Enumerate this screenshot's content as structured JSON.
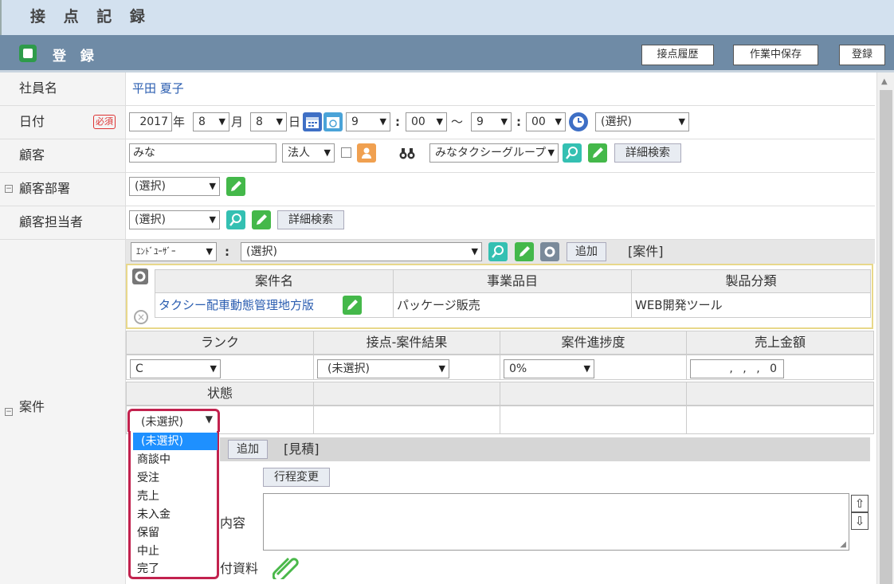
{
  "window": {
    "title": "接 点 記 録"
  },
  "header": {
    "title": "登 録",
    "buttons": [
      "接点履歴",
      "作業中保存",
      "登録"
    ]
  },
  "fields": {
    "employee": {
      "label": "社員名",
      "value": "平田 夏子"
    },
    "date": {
      "label": "日付",
      "required": "必須",
      "year": "2017",
      "year_unit": "年",
      "month": "8",
      "month_unit": "月",
      "day": "8",
      "day_unit": "日",
      "start_hour": "9",
      "start_min": "00",
      "sep_colon": ":",
      "tilde": "〜",
      "end_hour": "9",
      "end_min": "00",
      "select": "(選択)"
    },
    "customer": {
      "label": "顧客",
      "value": "みな",
      "type": "法人",
      "group": "みなタクシーグループ",
      "detail_search": "詳細検索"
    },
    "customer_dept": {
      "label": "顧客部署",
      "value": "(選択)"
    },
    "customer_contact": {
      "label": "顧客担当者",
      "value": "(選択)",
      "detail_search": "詳細検索"
    },
    "case": {
      "label": "案件",
      "enduser_select": "ｴﾝﾄﾞﾕｰｻﾞｰ",
      "colon": ":",
      "case_select": "(選択)",
      "add_label": "追加",
      "section_tag": "[案件]",
      "table_headers": [
        "案件名",
        "事業品目",
        "製品分類"
      ],
      "table_row": {
        "name": "タクシー配車動態管理地方版",
        "item": "パッケージ販売",
        "category": "WEB開発ツール"
      },
      "sub_headers": [
        "ランク",
        "接点-案件結果",
        "案件進捗度",
        "売上金額"
      ],
      "rank": "C",
      "result": "(未選択)",
      "progress": "0%",
      "amount": ", , , 0",
      "status_header": "状態",
      "status_value": "(未選択)",
      "estimate_add": "追加",
      "estimate_tag": "[見積]",
      "schedule_change": "行程変更",
      "content_label_partial": "内容",
      "attach_label_partial": "付資料"
    }
  },
  "status_dropdown": {
    "options": [
      "(未選択)",
      "商談中",
      "受注",
      "売上",
      "未入金",
      "保留",
      "中止",
      "完了"
    ],
    "selected_index": 0
  }
}
